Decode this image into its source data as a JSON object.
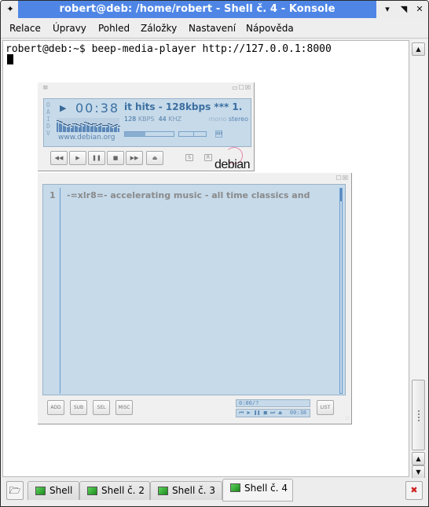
{
  "window": {
    "title": "robert@deb: /home/robert - Shell č. 4 - Konsole",
    "pin_icon": "✦",
    "minimize_icon": "▾",
    "maximize_icon": "◥",
    "close_icon": "✕"
  },
  "menubar": {
    "items": [
      {
        "label": "Relace"
      },
      {
        "label": "Úpravy"
      },
      {
        "label": "Pohled"
      },
      {
        "label": "Záložky"
      },
      {
        "label": "Nastavení"
      },
      {
        "label": "Nápověda"
      }
    ]
  },
  "terminal": {
    "prompt": "robert@deb:~$ ",
    "command": "beep-media-player http://127.0.0.1:8000",
    "scroll_up_icon": "▲",
    "scroll_down_icon": "▼"
  },
  "player": {
    "menu_icon": "≡",
    "window_buttons": "▭☐☒",
    "oaidv": [
      "O",
      "A",
      "I",
      "D",
      "V"
    ],
    "play_indicator": "▶",
    "time": "00:38",
    "visualizer_levels": [
      0.85,
      0.75,
      0.7,
      0.55,
      0.5,
      0.45,
      0.5,
      0.35,
      0.6,
      0.55,
      0.5,
      0.4,
      0.55,
      0.5,
      0.7,
      0.65,
      0.55,
      0.5,
      0.6,
      0.55,
      0.45,
      0.5,
      0.6,
      0.45,
      0.4,
      0.45,
      0.55,
      0.5,
      0.35,
      0.4,
      0.5,
      0.35
    ],
    "url": "www.debian.org",
    "song_title": "it hits - 128kbps  ***  1.",
    "bitrate": "128",
    "bitrate_unit": "KBPS",
    "samplerate": "44",
    "samplerate_unit": "KHZ",
    "mono_label": "mono",
    "stereo_label": "stereo",
    "seek_progress": 0.42,
    "eq_button": "▮▮▮",
    "playlist_button": "☰",
    "controls": {
      "prev": "◀◀",
      "play": "▶",
      "pause": "❚❚",
      "stop": "■",
      "next": "▶▶",
      "eject": "⏏"
    },
    "shuffle_label": "S",
    "repeat_label": "R",
    "logo_text": "debian"
  },
  "playlist": {
    "window_buttons": "☐☒",
    "entries": [
      {
        "number": "1",
        "title": "-=xlr8=- accelerating music - all time classics and"
      }
    ],
    "buttons": {
      "add": "ADD",
      "sub": "SUB",
      "sel": "SEL",
      "misc": "MISC",
      "list": "LIST"
    },
    "time_readout": "0:00/?",
    "mini_controls": "⏮ ▶ ❚❚ ■ ⏭ ⏏",
    "mini_time": "00:38",
    "resize_grip": "∷"
  },
  "tabs": {
    "new_tab_icon": "🗁",
    "items": [
      {
        "label": "Shell",
        "active": false
      },
      {
        "label": "Shell č. 2",
        "active": false
      },
      {
        "label": "Shell č. 3",
        "active": false
      },
      {
        "label": "Shell č. 4",
        "active": true
      }
    ],
    "close_tab_icon": "✖"
  }
}
